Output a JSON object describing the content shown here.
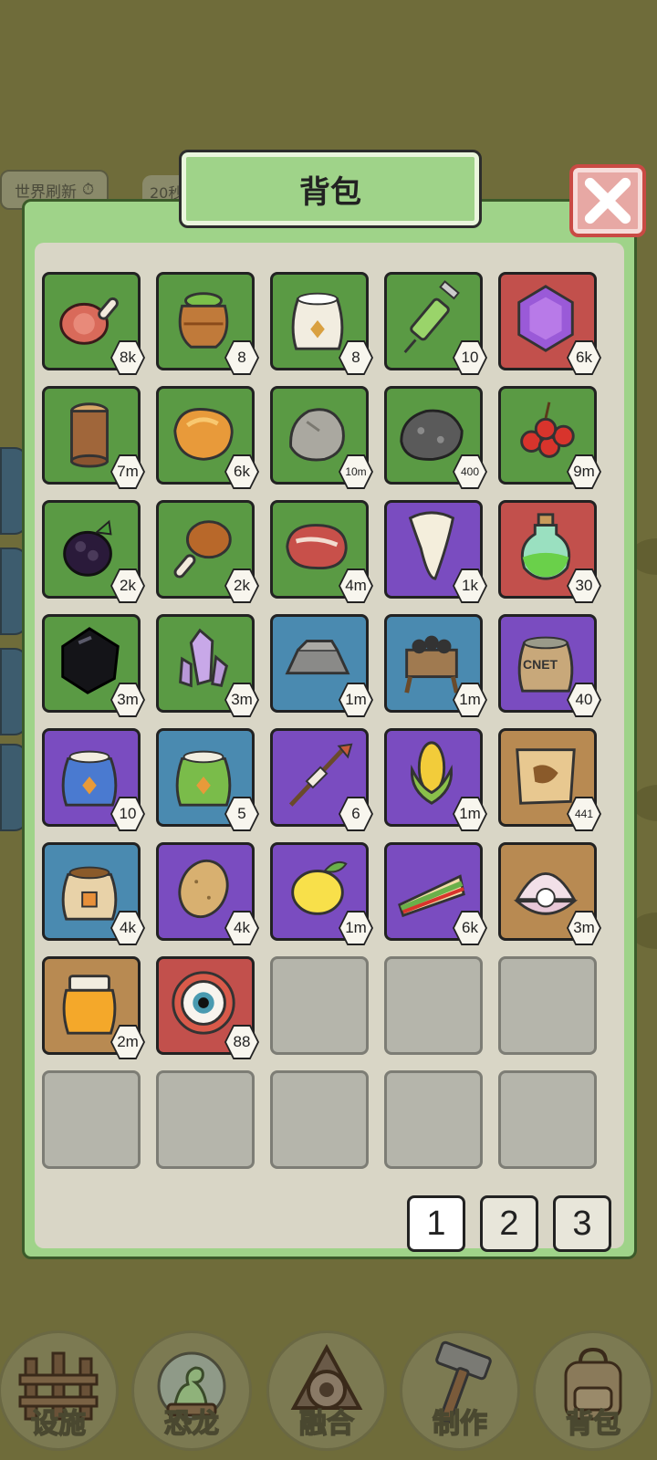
{
  "background": {
    "refresh_label": "世界刷新",
    "timer_text": "20秒"
  },
  "modal": {
    "title": "背包"
  },
  "slots": [
    {
      "name": "meat-ham",
      "count": "8k",
      "color": "green"
    },
    {
      "name": "clay-pot",
      "count": "8",
      "color": "green"
    },
    {
      "name": "flour-sack",
      "count": "8",
      "color": "green"
    },
    {
      "name": "green-syringe",
      "count": "10",
      "color": "green"
    },
    {
      "name": "purple-gem",
      "count": "6k",
      "color": "red"
    },
    {
      "name": "wood-log",
      "count": "7m",
      "color": "green"
    },
    {
      "name": "amber-stone",
      "count": "6k",
      "color": "green"
    },
    {
      "name": "grey-rock",
      "count": "10m",
      "color": "green"
    },
    {
      "name": "dark-ore",
      "count": "400",
      "color": "green"
    },
    {
      "name": "red-berries",
      "count": "9m",
      "color": "green"
    },
    {
      "name": "blackberry",
      "count": "2k",
      "color": "green"
    },
    {
      "name": "drumstick",
      "count": "2k",
      "color": "green"
    },
    {
      "name": "steak",
      "count": "4m",
      "color": "green"
    },
    {
      "name": "dino-tooth",
      "count": "1k",
      "color": "purple"
    },
    {
      "name": "green-potion",
      "count": "30",
      "color": "red"
    },
    {
      "name": "obsidian",
      "count": "3m",
      "color": "green"
    },
    {
      "name": "crystal-cluster",
      "count": "3m",
      "color": "green"
    },
    {
      "name": "iron-ingot",
      "count": "1m",
      "color": "blue"
    },
    {
      "name": "coal-cart",
      "count": "1m",
      "color": "blue"
    },
    {
      "name": "cnet-sack",
      "count": "40",
      "color": "purple",
      "label": "CNET"
    },
    {
      "name": "blue-seed-bag",
      "count": "10",
      "color": "purple"
    },
    {
      "name": "green-seed-bag",
      "count": "5",
      "color": "blue"
    },
    {
      "name": "arrow-syringe",
      "count": "6",
      "color": "purple"
    },
    {
      "name": "corn",
      "count": "1m",
      "color": "purple"
    },
    {
      "name": "treasure-map",
      "count": "441",
      "color": "brown"
    },
    {
      "name": "seed-pouch",
      "count": "4k",
      "color": "blue"
    },
    {
      "name": "potato",
      "count": "4k",
      "color": "purple"
    },
    {
      "name": "lemon",
      "count": "1m",
      "color": "purple"
    },
    {
      "name": "sandwich",
      "count": "6k",
      "color": "purple"
    },
    {
      "name": "pearl-shell",
      "count": "3m",
      "color": "brown"
    },
    {
      "name": "honey-jar",
      "count": "2m",
      "color": "brown"
    },
    {
      "name": "eyeball",
      "count": "88",
      "color": "red"
    },
    {
      "name": "",
      "count": "",
      "color": "empty"
    },
    {
      "name": "",
      "count": "",
      "color": "empty"
    },
    {
      "name": "",
      "count": "",
      "color": "empty"
    },
    {
      "name": "",
      "count": "",
      "color": "empty"
    },
    {
      "name": "",
      "count": "",
      "color": "empty"
    },
    {
      "name": "",
      "count": "",
      "color": "empty"
    },
    {
      "name": "",
      "count": "",
      "color": "empty"
    },
    {
      "name": "",
      "count": "",
      "color": "empty"
    }
  ],
  "pager": {
    "pages": [
      "1",
      "2",
      "3"
    ],
    "current": "1"
  },
  "nav": {
    "facilities": "设施",
    "dinosaur": "恐龙",
    "fusion": "融合",
    "crafting": "制作",
    "backpack": "背包"
  }
}
